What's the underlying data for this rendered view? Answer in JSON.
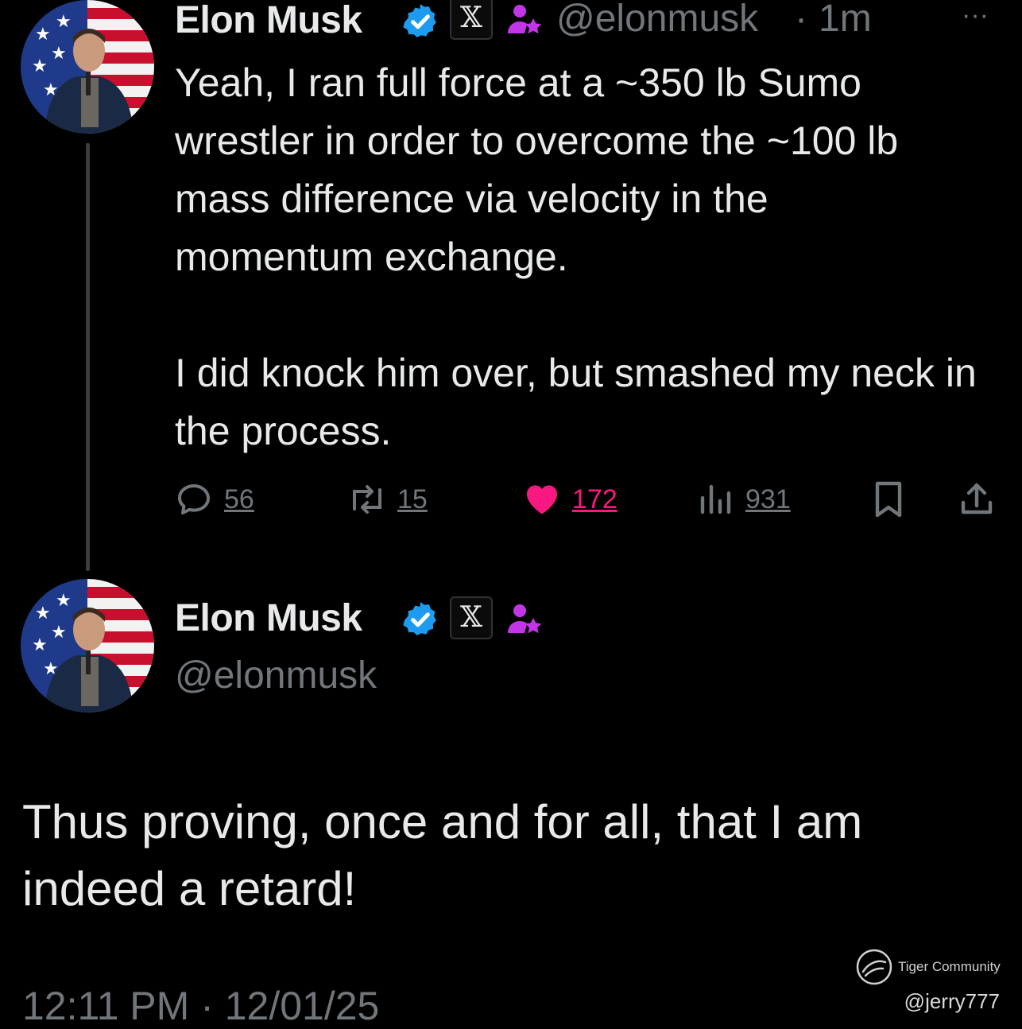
{
  "parent_tweet": {
    "author_name": "Elon Musk",
    "handle": "@elonmusk",
    "separator": "·",
    "time_ago": "1m",
    "more_label": "···",
    "badges": {
      "affiliate_label": "𝕏",
      "verified_color": "#1d9bf0",
      "member_icon_color": "#c236e8"
    },
    "text": "Yeah, I ran full force at a ~350 lb Sumo wrestler in order to overcome the ~100 lb mass difference via velocity in the momentum exchange.\n\nI did knock him over, but smashed my neck in the process.",
    "actions": {
      "replies": "56",
      "reposts": "15",
      "likes": "172",
      "views": "931"
    },
    "liked": true,
    "like_color": "#f91880"
  },
  "main_tweet": {
    "author_name": "Elon Musk",
    "handle": "@elonmusk",
    "badges": {
      "affiliate_label": "𝕏"
    },
    "text": "Thus proving, once and for all, that I am indeed a retard!",
    "timestamp": "12:11 PM · 12/01/25"
  },
  "watermark": {
    "label": "Tiger Community",
    "user": "@jerry777"
  },
  "icons": {
    "reply": "speech-bubble-icon",
    "repost": "repost-arrows-icon",
    "like": "heart-icon",
    "views": "bar-chart-icon",
    "bookmark": "bookmark-icon",
    "share": "share-upload-icon"
  }
}
